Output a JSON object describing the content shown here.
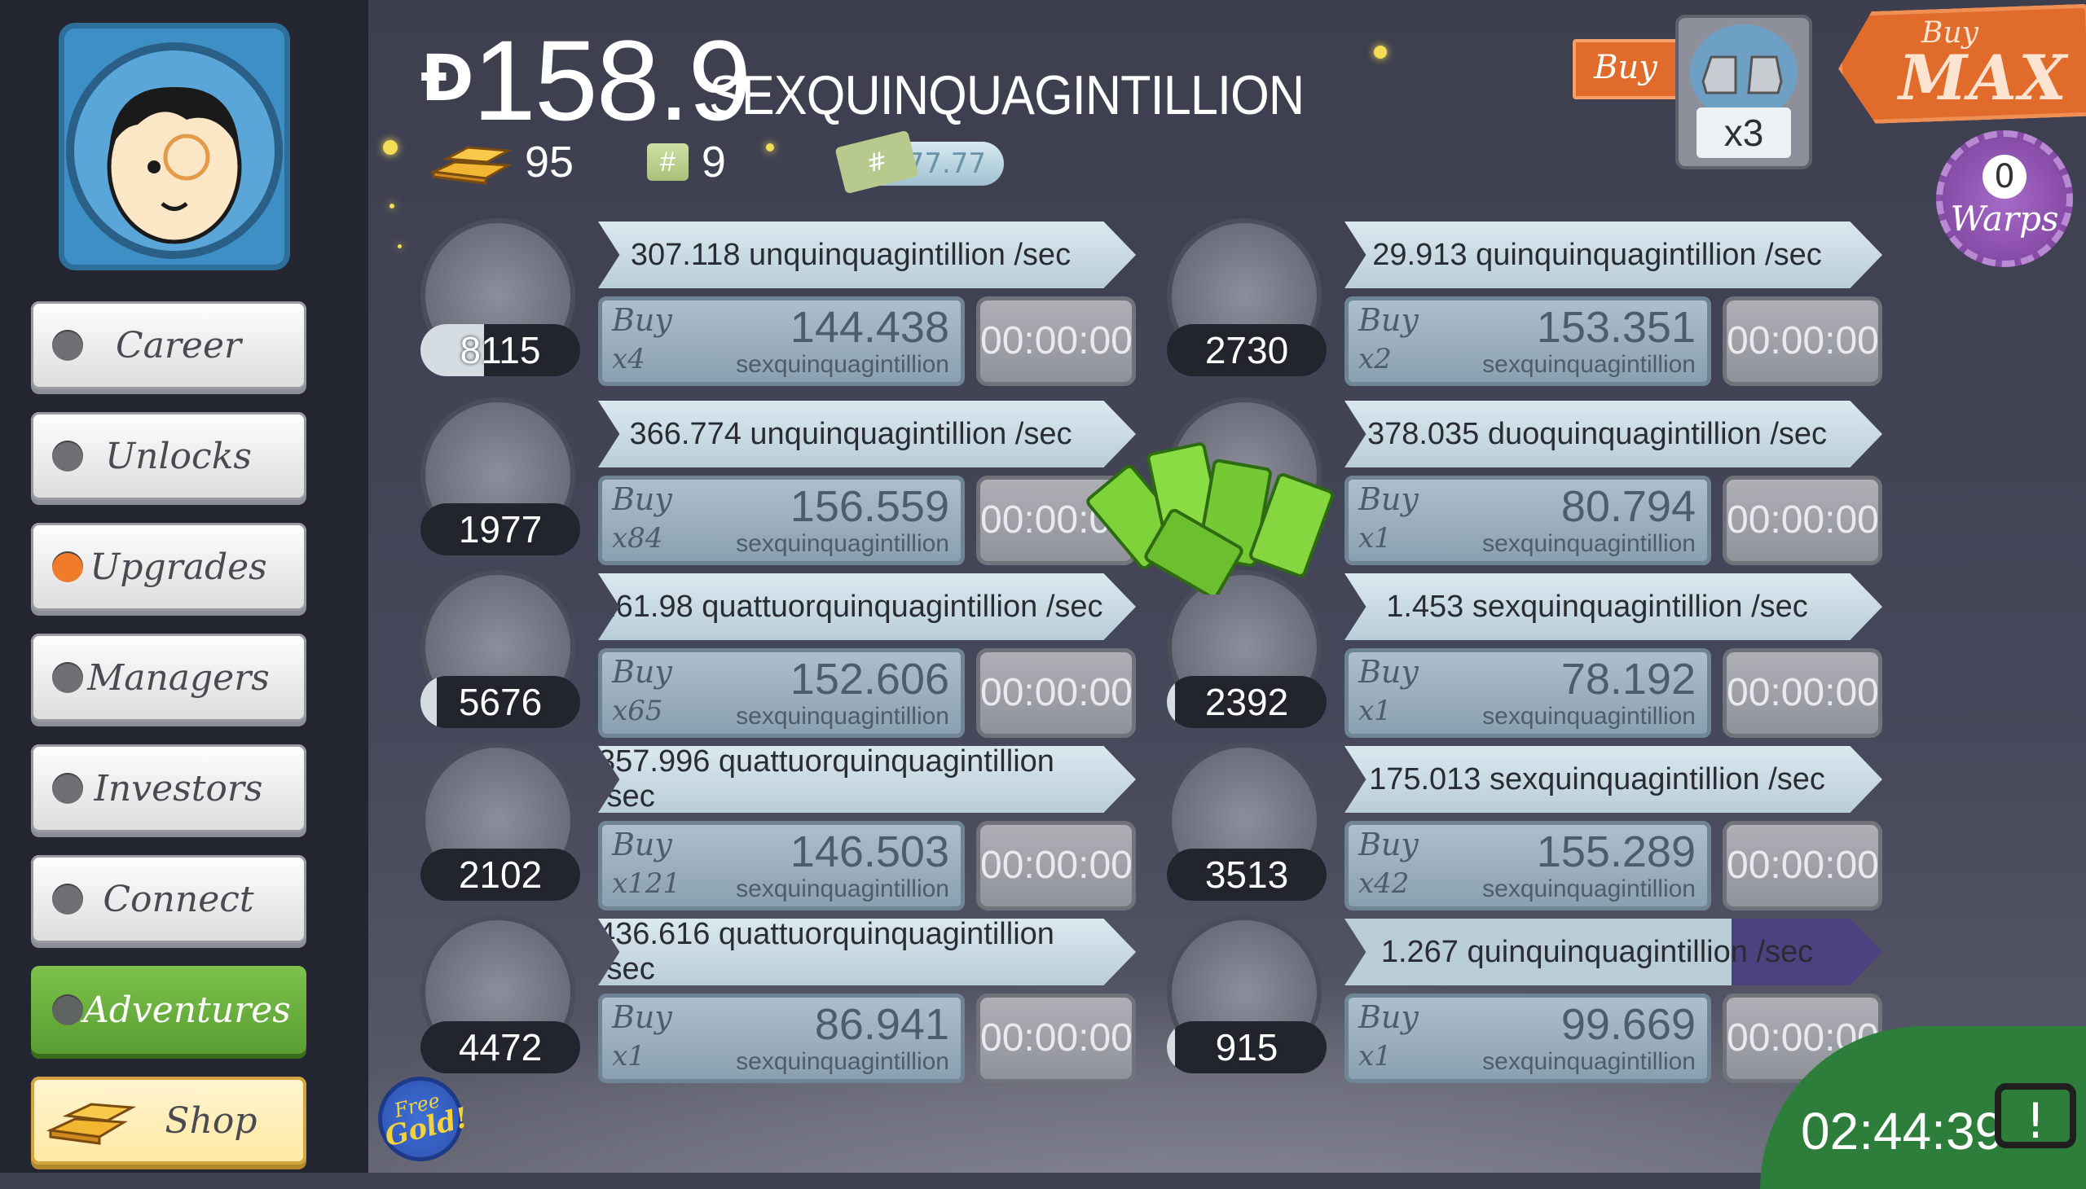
{
  "header": {
    "cash_symbol": "Đ",
    "cash_value": "158.9",
    "cash_unit": "SEXQUINQUAGINTILLION",
    "gold_bars": "95",
    "megatickets": "9",
    "ticket_symbol": "#",
    "multiplier_pill": "x777.77"
  },
  "buy_mode": {
    "buy_label": "Buy",
    "multiplier": "x3",
    "buymax_small": "Buy",
    "buymax_big": "MAX"
  },
  "warps": {
    "count": "0",
    "label": "Warps"
  },
  "sidebar": {
    "items": [
      {
        "label": "Career"
      },
      {
        "label": "Unlocks"
      },
      {
        "label": "Upgrades"
      },
      {
        "label": "Managers"
      },
      {
        "label": "Investors"
      },
      {
        "label": "Connect"
      },
      {
        "label": "Adventures"
      },
      {
        "label": "Shop"
      }
    ]
  },
  "businesses": [
    {
      "owned": "8115",
      "rate": "307.118 unquinquagintillion /sec",
      "buy": "Buy",
      "qty": "x4",
      "cost": "144.438",
      "unit": "sexquinquagintillion",
      "timer": "00:00:00",
      "icon": "moon-boots-icon",
      "owned_progress": 0.4
    },
    {
      "owned": "2730",
      "rate": "29.913 quinquinquagintillion /sec",
      "buy": "Buy",
      "qty": "x2",
      "cost": "153.351",
      "unit": "sexquinquagintillion",
      "timer": "00:00:00",
      "icon": "space-barn-icon",
      "owned_progress": 0.0
    },
    {
      "owned": "1977",
      "rate": "366.774 unquinquagintillion /sec",
      "buy": "Buy",
      "qty": "x84",
      "cost": "156.559",
      "unit": "sexquinquagintillion",
      "timer": "00:00:00",
      "icon": "police-box-icon",
      "owned_progress": 0.0
    },
    {
      "owned": "",
      "rate": "378.035 duoquinquagintillion /sec",
      "buy": "Buy",
      "qty": "x1",
      "cost": "80.794",
      "unit": "sexquinquagintillion",
      "timer": "00:00:00",
      "icon": "cheese-mine-icon",
      "owned_progress": 0.0
    },
    {
      "owned": "5676",
      "rate": "161.98 quattuorquinquagintillion /sec",
      "buy": "Buy",
      "qty": "x65",
      "cost": "152.606",
      "unit": "sexquinquagintillion",
      "timer": "00:00:00",
      "icon": "clones-icon",
      "owned_progress": 0.1
    },
    {
      "owned": "2392",
      "rate": "1.453 sexquinquagintillion /sec",
      "buy": "Buy",
      "qty": "x1",
      "cost": "78.192",
      "unit": "sexquinquagintillion",
      "timer": "00:00:00",
      "icon": "rollercoaster-icon",
      "owned_progress": 0.05
    },
    {
      "owned": "2102",
      "rate": "357.996 quattuorquinquagintillion /sec",
      "buy": "Buy",
      "qty": "x121",
      "cost": "146.503",
      "unit": "sexquinquagintillion",
      "timer": "00:00:00",
      "icon": "moon-rocket-icon",
      "owned_progress": 0.0
    },
    {
      "owned": "3513",
      "rate": "175.013 sexquinquagintillion /sec",
      "buy": "Buy",
      "qty": "x42",
      "cost": "155.289",
      "unit": "sexquinquagintillion",
      "timer": "00:00:00",
      "icon": "werewolf-icon",
      "owned_progress": 0.0
    },
    {
      "owned": "4472",
      "rate": "436.616 quattuorquinquagintillion /sec",
      "buy": "Buy",
      "qty": "x1",
      "cost": "86.941",
      "unit": "sexquinquagintillion",
      "timer": "00:00:00",
      "icon": "moon-shine-icon",
      "owned_progress": 0.0
    },
    {
      "owned": "915",
      "rate": "1.267 quinquinquagintillion /sec",
      "buy": "Buy",
      "qty": "x1",
      "cost": "99.669",
      "unit": "sexquinquagintillion",
      "timer": "00:00:00",
      "icon": "ray-gun-icon",
      "owned_progress": 0.05,
      "rate_progress": 0.72
    }
  ],
  "free_gold": {
    "line1": "Free",
    "line2": "Gold!"
  },
  "tv": {
    "time": "02:44:39",
    "icon_glyph": "!"
  },
  "colors": {
    "accent": "#e06b2a",
    "adventures": "#6fb340",
    "sidebar": "#232631",
    "warps": "#8d51ad"
  }
}
